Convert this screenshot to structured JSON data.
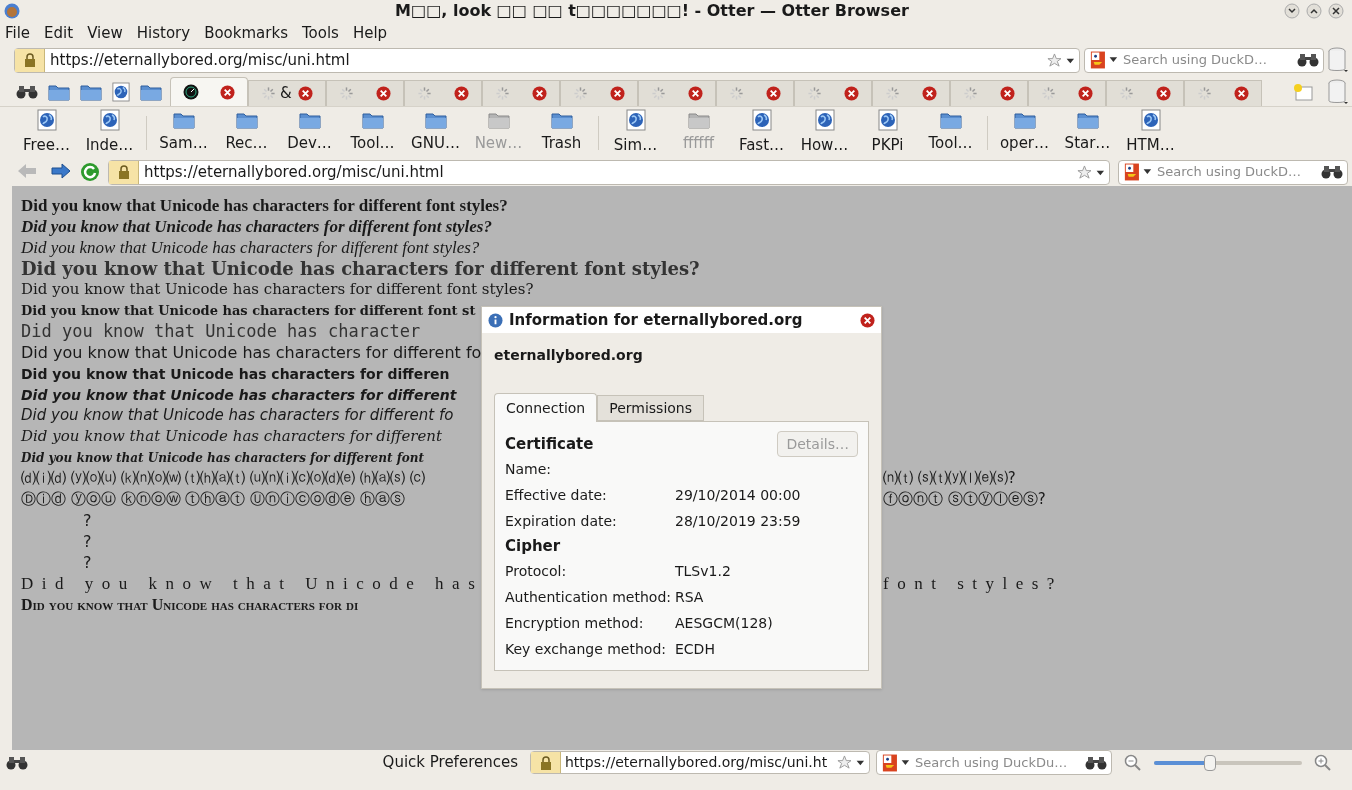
{
  "window": {
    "title": "M□□, look □□ □□ t□□□□□□□! - Otter — Otter Browser"
  },
  "menu": [
    "File",
    "Edit",
    "View",
    "History",
    "Bookmarks",
    "Tools",
    "Help"
  ],
  "address_bar": {
    "url": "https://eternallybored.org/misc/uni.html",
    "search_placeholder": "Search using DuckD…"
  },
  "tabs": [
    {
      "selected": true
    },
    {
      "title": "&",
      "selected": false
    },
    {
      "selected": false
    },
    {
      "selected": false
    },
    {
      "selected": false
    },
    {
      "selected": false
    },
    {
      "selected": false
    },
    {
      "selected": false
    },
    {
      "selected": false
    },
    {
      "selected": false
    },
    {
      "selected": false
    },
    {
      "selected": false
    },
    {
      "selected": false
    },
    {
      "selected": false
    }
  ],
  "bookmarks": [
    {
      "kind": "page",
      "label": "Free…",
      "disabled": false
    },
    {
      "kind": "page",
      "label": "Inde…",
      "disabled": false
    },
    {
      "kind": "separator"
    },
    {
      "kind": "folder",
      "label": "Sam…",
      "disabled": false
    },
    {
      "kind": "folder",
      "label": "Rec…",
      "disabled": false
    },
    {
      "kind": "folder",
      "label": "Dev…",
      "disabled": false
    },
    {
      "kind": "folder",
      "label": "Tool…",
      "disabled": false
    },
    {
      "kind": "folder",
      "label": "GNU…",
      "disabled": false
    },
    {
      "kind": "folder",
      "label": "New…",
      "disabled": true
    },
    {
      "kind": "folder",
      "label": "Trash",
      "disabled": false
    },
    {
      "kind": "separator"
    },
    {
      "kind": "page",
      "label": "Sim…",
      "disabled": false
    },
    {
      "kind": "folder",
      "label": "ffffff",
      "disabled": true
    },
    {
      "kind": "page",
      "label": "Fast…",
      "disabled": false
    },
    {
      "kind": "page",
      "label": "How…",
      "disabled": false
    },
    {
      "kind": "page",
      "label": "PKPi",
      "disabled": false
    },
    {
      "kind": "folder",
      "label": "Tool…",
      "disabled": false
    },
    {
      "kind": "separator"
    },
    {
      "kind": "folder",
      "label": "oper…",
      "disabled": false
    },
    {
      "kind": "folder",
      "label": "Star…",
      "disabled": false
    },
    {
      "kind": "page",
      "label": "HTM…",
      "disabled": false
    }
  ],
  "navigation_bar": {
    "url": "https://eternallybored.org/misc/uni.html",
    "search_placeholder": "Search using DuckD…"
  },
  "page_lines": [
    {
      "kind": "serif-bold",
      "text": "Did you know that Unicode has characters for different font styles?"
    },
    {
      "kind": "serif-bold-italic",
      "text": "Did you know that Unicode has characters for different font styles?"
    },
    {
      "kind": "serif-italic",
      "text": "Did you know that Unicode has characters for different font styles?"
    },
    {
      "kind": "double-struck",
      "text": "Did you know that Unicode has characters for different font styles?"
    },
    {
      "kind": "fraktur",
      "text": "Did you know that Unicode has characters for different font styles?"
    },
    {
      "kind": "fraktur-bold",
      "text": "Did you know that Unicode has characters for different font st"
    },
    {
      "kind": "mono",
      "text": "Did you know that Unicode has character"
    },
    {
      "kind": "sans",
      "text": "Did you know that Unicode has characters for different fo"
    },
    {
      "kind": "sans-bold",
      "text": "Did you know that Unicode has characters for differen"
    },
    {
      "kind": "sans-bold-italic",
      "text": "Did you know that Unicode has characters for different"
    },
    {
      "kind": "sans-italic",
      "text": "Did you know that Unicode has characters for different fo"
    },
    {
      "kind": "script",
      "text": "Did you know that Unicode has characters for different"
    },
    {
      "kind": "script-bold",
      "text": "Did you know that Unicode has characters for different font"
    },
    {
      "kind": "parenthesized",
      "text": "⒟⒤⒟ ⒴⒪⒰ ⒦⒩⒪⒲ ⒯⒣⒜⒯ ⒰⒩⒤⒞⒪⒟⒠ ⒣⒜⒮ ⒞",
      "tail": "⒩⒯ ⒮⒯⒴⒧⒠⒮?"
    },
    {
      "kind": "circled",
      "text": "Ⓓⓘⓓ ⓨⓞⓤ ⓚⓝⓞⓦ ⓣⓗⓐⓣ Ⓤⓝⓘⓒⓞⓓⓔ ⓗⓐⓢ",
      "tail": "ⓕⓞⓝⓣ ⓢⓣⓨⓛⓔⓢ?"
    },
    {
      "kind": "mark",
      "text": "?"
    },
    {
      "kind": "mark",
      "text": "?"
    },
    {
      "kind": "mark",
      "text": "?"
    },
    {
      "kind": "spaced",
      "text": "Did you know that Unicode has",
      "tail": "font styles?"
    },
    {
      "kind": "small-caps",
      "text": "Did you know that Unicode has characters for di"
    }
  ],
  "dialog": {
    "title": "Information for eternallybored.org",
    "host": "eternallybored.org",
    "tabs": [
      {
        "label": "Connection",
        "selected": true
      },
      {
        "label": "Permissions",
        "selected": false
      }
    ],
    "sections": [
      {
        "heading": "Certificate",
        "button": {
          "label": "Details…",
          "disabled": true
        },
        "rows": [
          {
            "label": "Name:"
          },
          {
            "label": "Effective date:",
            "value": "29/10/2014 00:00"
          },
          {
            "label": "Expiration date:",
            "value": "28/10/2019 23:59"
          }
        ]
      },
      {
        "heading": "Cipher",
        "rows": [
          {
            "label": "Protocol:",
            "value": "TLSv1.2"
          },
          {
            "label": "Authentication method:",
            "value": "RSA"
          },
          {
            "label": "Encryption method:",
            "value": "AESGCM(128)"
          },
          {
            "label": "Key exchange method:",
            "value": "ECDH"
          }
        ]
      }
    ]
  },
  "status_bar": {
    "label": "Quick Preferences",
    "url": "https://eternallybored.org/misc/uni.ht",
    "search_placeholder": "Search using DuckDu…",
    "zoom": {
      "level": 0.38
    }
  }
}
